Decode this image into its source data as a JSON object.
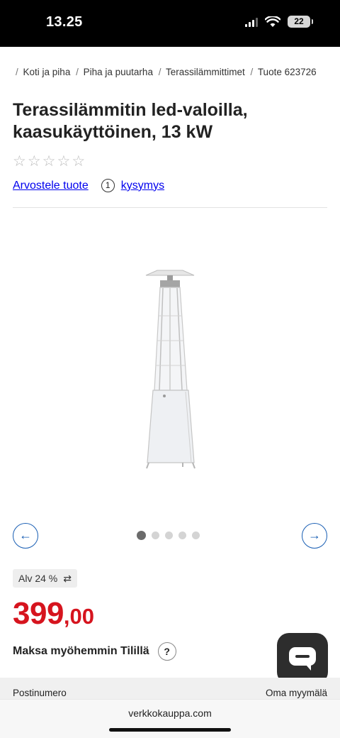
{
  "status": {
    "time": "13.25",
    "battery": "22"
  },
  "breadcrumb": {
    "items": [
      "Koti ja piha",
      "Piha ja puutarha",
      "Terassilämmittimet"
    ],
    "current": "Tuote 623726"
  },
  "product": {
    "title": "Terassilämmitin led-valoilla, kaasukäyttöinen, 13 kW",
    "rating": 0,
    "rating_max": 5,
    "review_link": "Arvostele tuote",
    "question_count": "1",
    "question_label": "kysymys"
  },
  "gallery": {
    "image_count": 5,
    "active_index": 0,
    "prev_icon": "arrow-left-icon",
    "next_icon": "arrow-right-icon"
  },
  "pricing": {
    "vat_label": "Alv 24 %",
    "price_int": "399",
    "price_dec": ",00",
    "price_color": "#d6141e",
    "pay_later": "Maksa myöhemmin Tilillä",
    "help_label": "?"
  },
  "delivery": {
    "postal_label": "Postinumero",
    "store_label": "Oma myymälä"
  },
  "browser": {
    "url": "verkkokauppa.com"
  },
  "colors": {
    "link": "#1a5fb4",
    "price": "#d6141e",
    "chat_button": "#2d2d2d"
  }
}
